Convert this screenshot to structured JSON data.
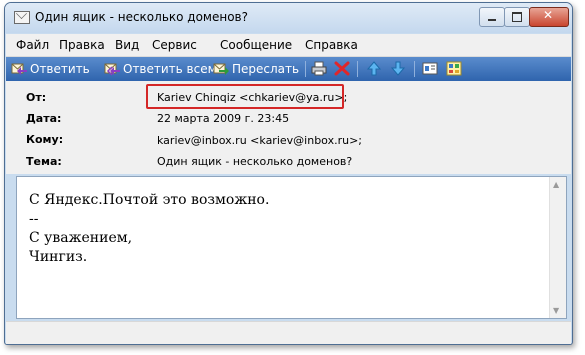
{
  "window": {
    "title": "Один ящик - несколько доменов?"
  },
  "menu": {
    "items": [
      "Файл",
      "Правка",
      "Вид",
      "Сервис",
      "Сообщение",
      "Справка"
    ]
  },
  "toolbar": {
    "reply": "Ответить",
    "reply_all": "Ответить всем",
    "forward": "Переслать",
    "icons": [
      "reply-icon",
      "reply-all-icon",
      "forward-icon",
      "print-icon",
      "delete-icon",
      "previous-icon",
      "next-icon",
      "contacts-icon",
      "encoding-icon"
    ]
  },
  "header": {
    "from_label": "От:",
    "from_value": "Kariev Chinqiz <chkariev@ya.ru>;",
    "date_label": "Дата:",
    "date_value": "22 марта 2009 г. 23:45",
    "to_label": "Кому:",
    "to_value": "kariev@inbox.ru <kariev@inbox.ru>;",
    "subject_label": "Тема:",
    "subject_value": "Один ящик - несколько доменов?"
  },
  "message": {
    "lines": [
      "С Яндекс.Почтой это возможно.",
      "--",
      "С уважением,",
      "Чингиз."
    ]
  },
  "colors": {
    "highlight_border": "#d42727",
    "toolbar_bg": "#3a6fb8"
  }
}
